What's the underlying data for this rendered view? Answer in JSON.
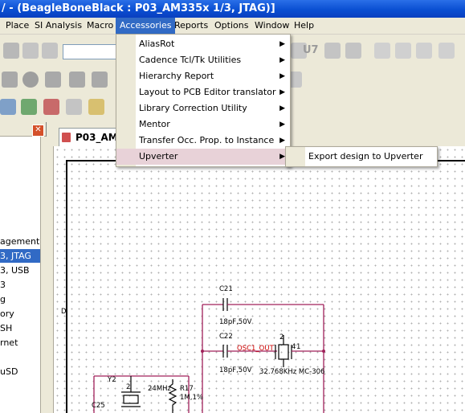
{
  "window": {
    "title": "/ - (BeagleBoneBlack : P03_AM335x 1/3, JTAG)]"
  },
  "menubar": {
    "items": [
      "Place",
      "SI Analysis",
      "Macro",
      "Accessories",
      "Reports",
      "Options",
      "Window",
      "Help"
    ],
    "active": "Accessories"
  },
  "accessories_menu": {
    "items": [
      {
        "label": "AliasRot"
      },
      {
        "label": "Cadence Tcl/Tk Utilities"
      },
      {
        "label": "Hierarchy Report"
      },
      {
        "label": "Layout to PCB Editor translator"
      },
      {
        "label": "Library Correction Utility"
      },
      {
        "label": "Mentor"
      },
      {
        "label": "Transfer Occ. Prop. to Instance"
      },
      {
        "label": "Upverter"
      }
    ],
    "highlighted": "Upverter"
  },
  "upverter_submenu": {
    "items": [
      "Export design to Upverter"
    ]
  },
  "toolbar": {
    "u7_label": "U7"
  },
  "left_panel": {
    "items": [
      "agement",
      "3, JTAG",
      "3, USB",
      "3",
      "g",
      "ory",
      "SH",
      "rnet",
      "",
      "uSD"
    ],
    "selected_index": 1
  },
  "document_tab": {
    "label": "P03_AM3"
  },
  "schematic": {
    "c21_ref": "C21",
    "c21_value": "18pF,50V",
    "c22_ref": "C22",
    "c22_value": "18pF,50V",
    "net_label": "OSC1_OUT",
    "crystal_value": "32.768KHz MC-306",
    "y2_ref": "Y2",
    "y2_freq": "24MHz",
    "r17_ref": "R17",
    "r17_value": "1M,1%",
    "c25_ref": "C25",
    "pin_2": "2",
    "pin_1": "1",
    "pin_4": "4",
    "pin_d": "D"
  },
  "colors": {
    "title_bar": "#0a4fd2",
    "menu_highlight": "#316ac5",
    "wire": "#a0205a",
    "net_label": "#cc0000"
  }
}
